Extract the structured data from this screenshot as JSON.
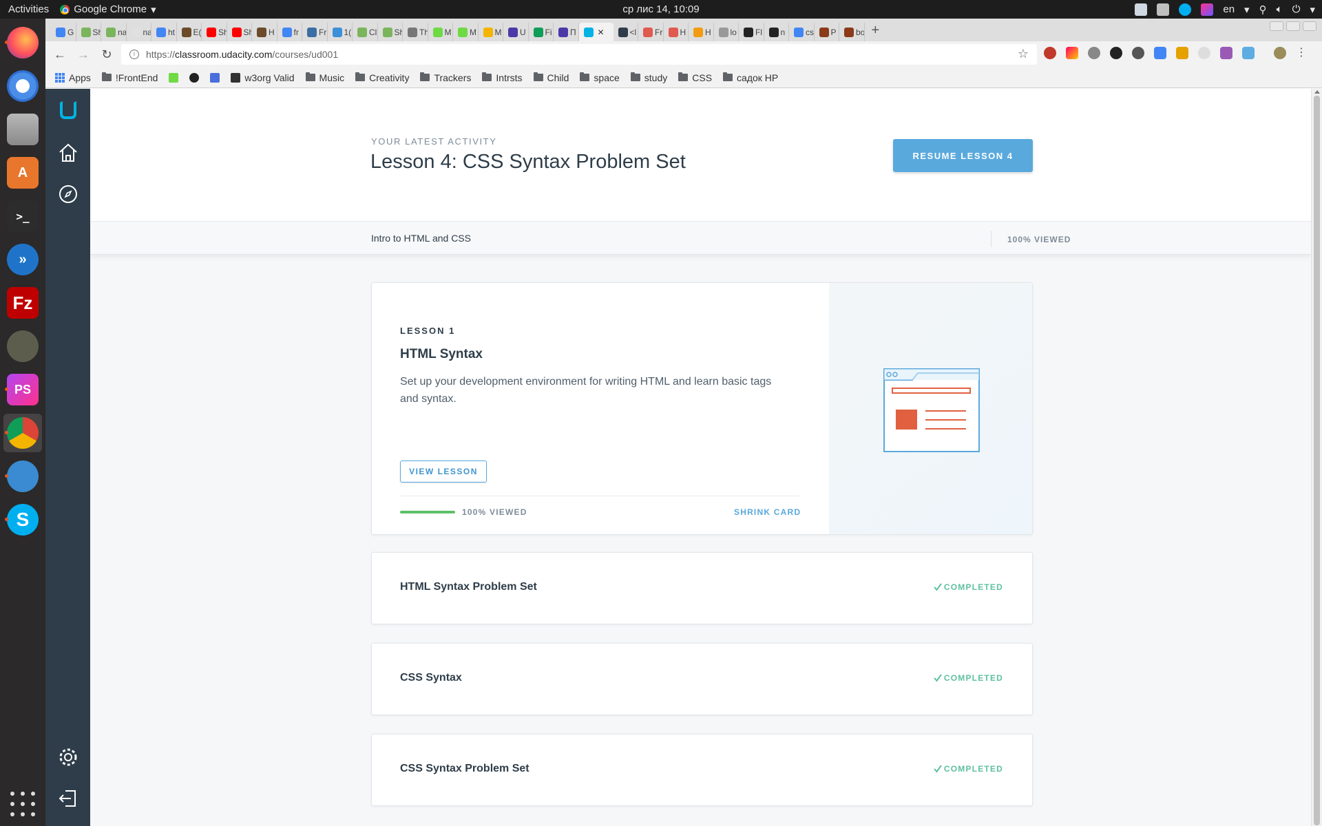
{
  "os": {
    "activities": "Activities",
    "app_name": "Google Chrome",
    "clock": "ср лис 14, 10:09",
    "language": "en"
  },
  "browser": {
    "tabs": [
      {
        "label": "G sh",
        "color": "#4285f4"
      },
      {
        "label": "Sh",
        "color": "#7ab55c"
      },
      {
        "label": "na",
        "color": "#7ab55c"
      },
      {
        "label": "na",
        "color": "#e0e0e0"
      },
      {
        "label": "ht",
        "color": "#4285f4"
      },
      {
        "label": "E(",
        "color": "#6b4b2a"
      },
      {
        "label": "Sh",
        "color": "#ff0000"
      },
      {
        "label": "Sh",
        "color": "#ff0000"
      },
      {
        "label": "H",
        "color": "#6b4b2a"
      },
      {
        "label": "fr",
        "color": "#4285f4"
      },
      {
        "label": "Fr",
        "color": "#3b6ea5"
      },
      {
        "label": "1(",
        "color": "#3d8fd8"
      },
      {
        "label": "Cl",
        "color": "#7ab55c"
      },
      {
        "label": "Sh",
        "color": "#7ab55c"
      },
      {
        "label": "Th",
        "color": "#777777"
      },
      {
        "label": "M",
        "color": "#6fda44"
      },
      {
        "label": "M",
        "color": "#6fda44"
      },
      {
        "label": "M",
        "color": "#f4b400"
      },
      {
        "label": "U",
        "color": "#4a3aa7"
      },
      {
        "label": "Fi",
        "color": "#0f9d58"
      },
      {
        "label": "П",
        "color": "#4a3aa7"
      },
      {
        "label": "",
        "color": "#02b3e4",
        "active": true
      },
      {
        "label": "<l",
        "color": "#2e3d49"
      },
      {
        "label": "Fr",
        "color": "#e05a4f"
      },
      {
        "label": "H",
        "color": "#e05a4f"
      },
      {
        "label": "H",
        "color": "#f39c12"
      },
      {
        "label": "lo",
        "color": "#999999"
      },
      {
        "label": "Fl",
        "color": "#222222"
      },
      {
        "label": "n",
        "color": "#222222"
      },
      {
        "label": "cs",
        "color": "#4285f4"
      },
      {
        "label": "P",
        "color": "#8b3a1a"
      },
      {
        "label": "bo",
        "color": "#8b3a1a"
      }
    ],
    "url_prefix": "https://",
    "url_host": "classroom.udacity.com",
    "url_path": "/courses/ud001",
    "bookmarks": [
      {
        "label": "Apps",
        "kind": "apps"
      },
      {
        "label": "!FrontEnd",
        "kind": "folder"
      },
      {
        "label": "",
        "kind": "upwork"
      },
      {
        "label": "",
        "kind": "github"
      },
      {
        "label": "",
        "kind": "shield"
      },
      {
        "label": "w3org Valid",
        "kind": "w3c"
      },
      {
        "label": "Music",
        "kind": "folder"
      },
      {
        "label": "Creativity",
        "kind": "folder"
      },
      {
        "label": "Trackers",
        "kind": "folder"
      },
      {
        "label": "Intrsts",
        "kind": "folder"
      },
      {
        "label": "Child",
        "kind": "folder"
      },
      {
        "label": "space",
        "kind": "folder"
      },
      {
        "label": "study",
        "kind": "folder"
      },
      {
        "label": "CSS",
        "kind": "folder"
      },
      {
        "label": "садок HP",
        "kind": "folder"
      }
    ]
  },
  "hero": {
    "kicker": "YOUR LATEST ACTIVITY",
    "title": "Lesson 4: CSS Syntax Problem Set",
    "resume_label": "RESUME LESSON 4"
  },
  "course": {
    "name": "Intro to HTML and CSS",
    "viewed": "100% VIEWED"
  },
  "lesson_card": {
    "label": "LESSON 1",
    "title": "HTML Syntax",
    "description": "Set up your development environment for writing HTML and learn basic tags and syntax.",
    "view_label": "VIEW LESSON",
    "progress_fraction": 1.0,
    "viewed": "100% VIEWED",
    "shrink_label": "SHRINK CARD"
  },
  "concepts": [
    {
      "title": "HTML Syntax Problem Set",
      "status": "COMPLETED"
    },
    {
      "title": "CSS Syntax",
      "status": "COMPLETED"
    },
    {
      "title": "CSS Syntax Problem Set",
      "status": "COMPLETED"
    }
  ],
  "colors": {
    "udacity_sidebar": "#2e3d49",
    "accent_blue": "#59a9dd",
    "completed_green": "#5ec0a0",
    "progress_green": "#5ec068"
  }
}
